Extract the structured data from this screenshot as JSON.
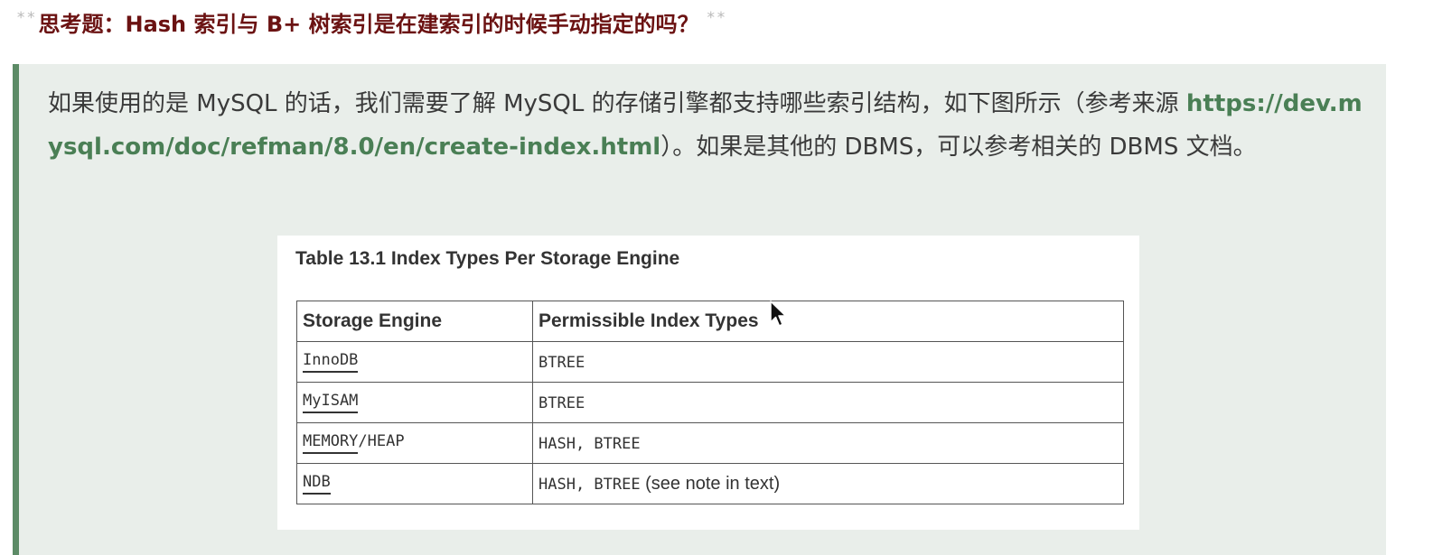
{
  "heading": {
    "prefix_marks": "**",
    "text": "思考题：Hash 索引与 B+ 树索引是在建索引的时候手动指定的吗？",
    "suffix_marks": "**"
  },
  "quote": {
    "text_before_link": "如果使用的是 MySQL 的话，我们需要了解 MySQL 的存储引擎都支持哪些索引结构，如下图所示（参考来源 ",
    "link": "https://dev.mysql.com/doc/refman/8.0/en/create-index.html",
    "text_after_link": "）。如果是其他的 DBMS，可以参考相关的 DBMS 文档。"
  },
  "figure": {
    "caption": "Table 13.1 Index Types Per Storage Engine",
    "columns": [
      "Storage Engine",
      "Permissible Index Types"
    ],
    "rows": [
      {
        "engine_link": "InnoDB",
        "engine_suffix": "",
        "types": "BTREE",
        "note": ""
      },
      {
        "engine_link": "MyISAM",
        "engine_suffix": "",
        "types": "BTREE",
        "note": ""
      },
      {
        "engine_link": "MEMORY",
        "engine_suffix": "/HEAP",
        "types": "HASH, BTREE",
        "note": ""
      },
      {
        "engine_link": "NDB",
        "engine_suffix": "",
        "types": "HASH, BTREE",
        "note": " (see note in text)"
      }
    ]
  },
  "colors": {
    "heading": "#6b1212",
    "quote_background": "#e9eeea",
    "quote_border": "#5c8b66",
    "link": "#4a7f55"
  },
  "icons": {
    "cursor": "arrow-cursor-icon"
  }
}
